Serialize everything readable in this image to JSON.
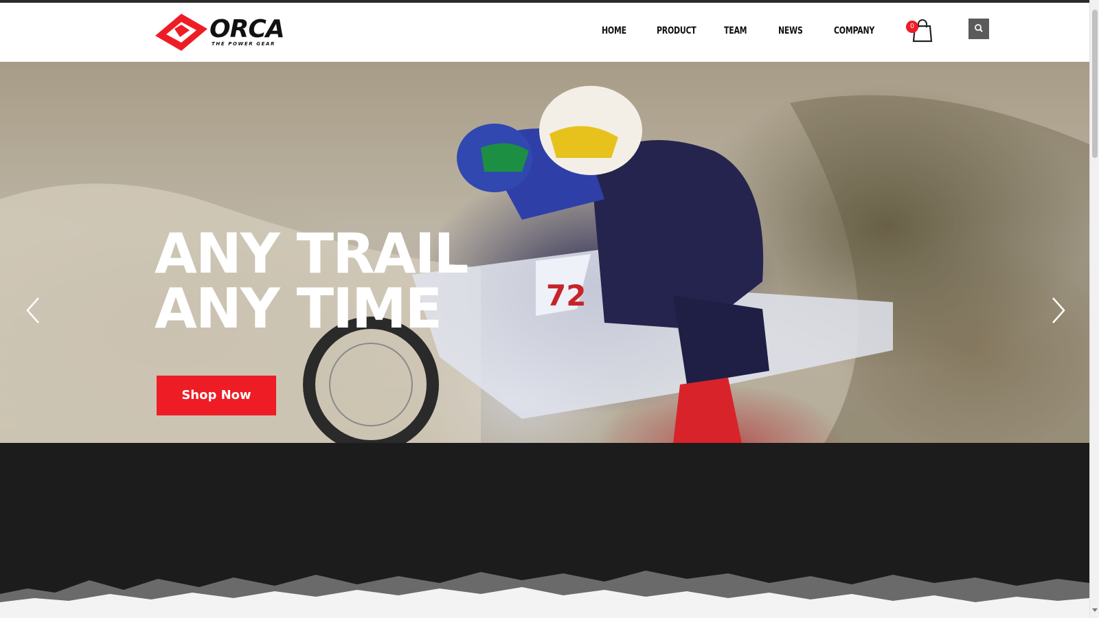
{
  "brand": {
    "name": "ORCA",
    "tagline": "THE POWER GEAR",
    "accent_color": "#ee1c25"
  },
  "nav": {
    "items": [
      {
        "label": "HOME"
      },
      {
        "label": "PRODUCT"
      },
      {
        "label": "TEAM"
      },
      {
        "label": "NEWS"
      },
      {
        "label": "COMPANY"
      }
    ]
  },
  "cart": {
    "count": "0",
    "icon": "shopping-bag-icon"
  },
  "search": {
    "icon": "search-icon"
  },
  "hero": {
    "title_line1": "ANY TRAIL",
    "title_line2": "ANY TIME",
    "cta_label": "Shop Now",
    "prev_icon": "chevron-left-icon",
    "next_icon": "chevron-right-icon"
  }
}
